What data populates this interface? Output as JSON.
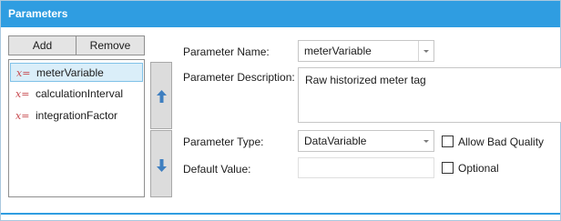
{
  "window": {
    "title": "Parameters"
  },
  "toolbar": {
    "add_label": "Add",
    "remove_label": "Remove"
  },
  "parameters": {
    "items": [
      {
        "icon": "x=",
        "label": "meterVariable",
        "selected": true
      },
      {
        "icon": "x=",
        "label": "calculationInterval",
        "selected": false
      },
      {
        "icon": "x=",
        "label": "integrationFactor",
        "selected": false
      }
    ]
  },
  "move": {
    "up_icon": "arrow-up-icon",
    "down_icon": "arrow-down-icon"
  },
  "form": {
    "name_label": "Parameter Name:",
    "name_value": "meterVariable",
    "description_label": "Parameter Description:",
    "description_value": "Raw historized meter tag",
    "type_label": "Parameter Type:",
    "type_value": "DataVariable",
    "allow_bad_quality_label": "Allow Bad Quality",
    "allow_bad_quality_checked": false,
    "default_label": "Default Value:",
    "default_value": "",
    "optional_label": "Optional",
    "optional_checked": false
  },
  "colors": {
    "title_bar": "#2f9de1",
    "selected_item": "#daeef9",
    "variable_icon": "#c84b50",
    "arrow_icon": "#3f7fc0"
  }
}
